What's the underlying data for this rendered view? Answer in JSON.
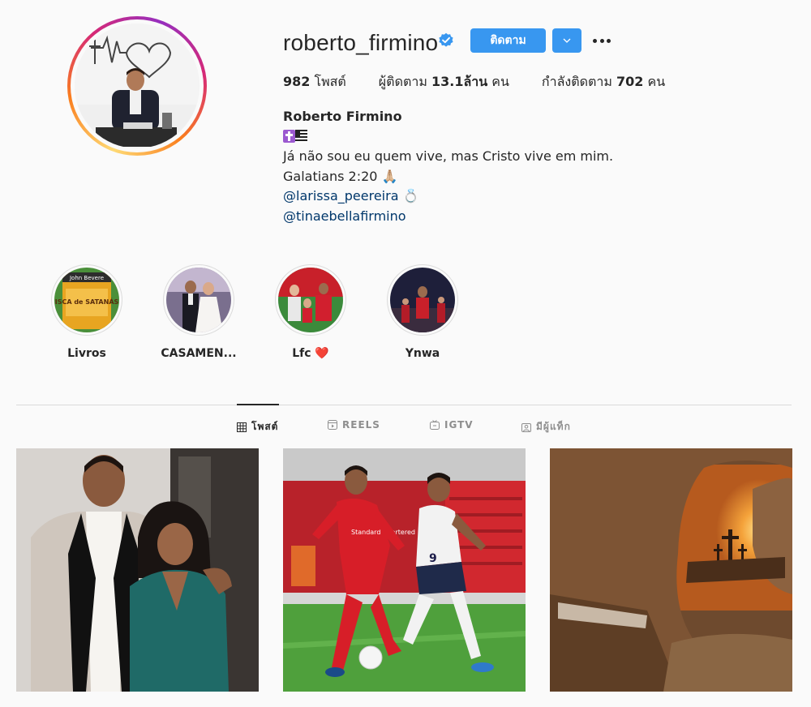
{
  "profile": {
    "username": "roberto_firmino",
    "follow_label": "ติดตาม",
    "stats": {
      "posts_count": "982",
      "posts_label": "โพสต์",
      "followers_label": "ผู้ติดตาม",
      "followers_count": "13.1ล้าน",
      "followers_unit": "คน",
      "following_label": "กำลังติดตาม",
      "following_count": "702",
      "following_unit": "คน"
    },
    "bio": {
      "full_name": "Roberto Firmino",
      "line_quote": "Já não sou eu quem vive, mas Cristo vive em mim.",
      "line_verse": "Galatians 2:20 🙏🏼",
      "mention_1": "@larissa_peereira",
      "mention_1_emoji": "💍",
      "mention_2": "@tinaebellafirmino"
    }
  },
  "highlights": [
    {
      "label": "Livros",
      "cover_text_1": "John Bevere",
      "cover_text_2": "ISCA de SATANÁS"
    },
    {
      "label": "CASAMEN..."
    },
    {
      "label": "Lfc ❤️"
    },
    {
      "label": "Ynwa"
    }
  ],
  "tabs": [
    {
      "label": "โพสต์",
      "icon": "grid-icon"
    },
    {
      "label": "REELS",
      "icon": "reels-icon"
    },
    {
      "label": "IGTV",
      "icon": "igtv-icon"
    },
    {
      "label": "มีผู้แท็ก",
      "icon": "tagged-icon"
    }
  ],
  "posts": [
    {
      "subject": "family-photo"
    },
    {
      "subject": "football-match",
      "jersey_sponsor": "Standard Chartered",
      "jersey_number": "9"
    },
    {
      "subject": "empty-tomb-crosses"
    }
  ],
  "colors": {
    "accent": "#3897f0",
    "link": "#00376b",
    "text": "#262626",
    "muted": "#8e8e8e",
    "divider": "#dbdbdb",
    "verified": "#3897f0"
  }
}
